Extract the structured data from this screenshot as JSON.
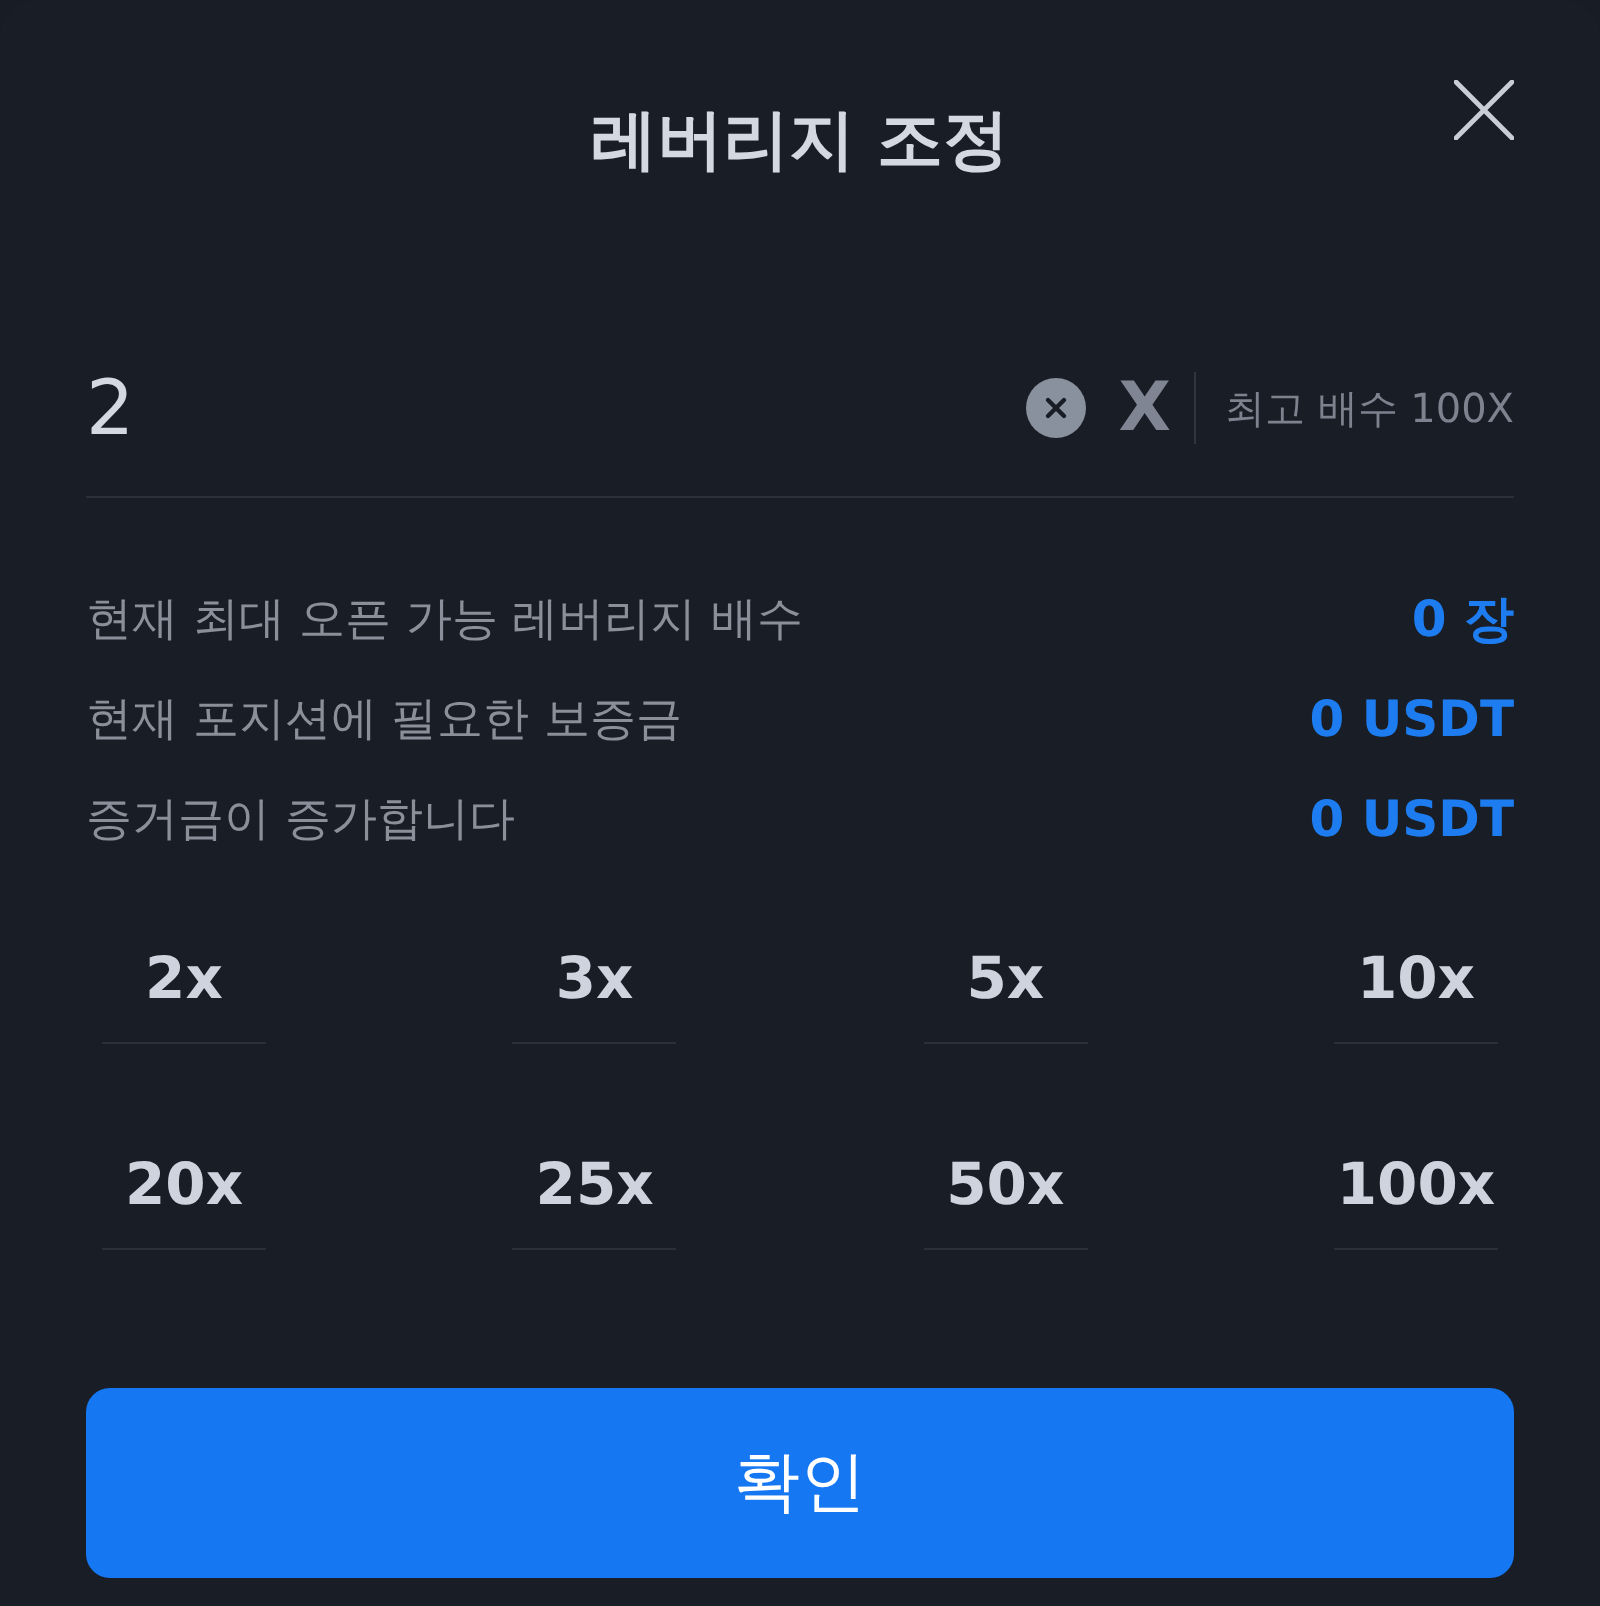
{
  "title": "레버리지 조정",
  "leverage_input": {
    "value": "2",
    "unit": "X",
    "max_label": "최고 배수 100X"
  },
  "info_rows": [
    {
      "label": "현재 최대 오픈 가능 레버리지 배수",
      "value": "0 장"
    },
    {
      "label": "현재 포지션에 필요한 보증금",
      "value": "0 USDT"
    },
    {
      "label": "증거금이 증가합니다",
      "value": "0 USDT"
    }
  ],
  "presets": [
    {
      "label": "2x",
      "selected": false
    },
    {
      "label": "3x",
      "selected": false
    },
    {
      "label": "5x",
      "selected": false
    },
    {
      "label": "10x",
      "selected": false
    },
    {
      "label": "20x",
      "selected": false
    },
    {
      "label": "25x",
      "selected": false
    },
    {
      "label": "50x",
      "selected": false
    },
    {
      "label": "100x",
      "selected": false
    }
  ],
  "confirm_button": "확인"
}
